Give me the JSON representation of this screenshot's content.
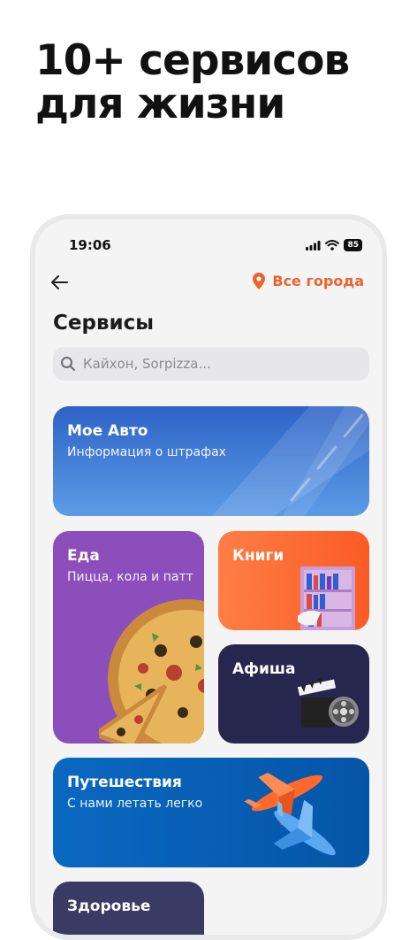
{
  "promo": {
    "line1": "10+ сервисов",
    "line2": "для жизни"
  },
  "status_bar": {
    "time": "19:06",
    "battery": "85"
  },
  "header": {
    "city": "Все города"
  },
  "page": {
    "title": "Сервисы"
  },
  "search": {
    "placeholder": "Кайхон, Sorpizza..."
  },
  "cards": {
    "auto": {
      "title": "Мое Авто",
      "subtitle": "Информация о штрафах"
    },
    "food": {
      "title": "Еда",
      "subtitle": "Пицца, кола и патт"
    },
    "books": {
      "title": "Книги"
    },
    "afisha": {
      "title": "Афиша"
    },
    "travel": {
      "title": "Путешествия",
      "subtitle": "С нами летать легко"
    },
    "health": {
      "title": "Здоровье"
    }
  },
  "icons": [
    "back-arrow-icon",
    "location-pin-icon",
    "search-icon",
    "signal-icon",
    "wifi-icon",
    "battery-icon",
    "pizza-icon",
    "bookshelf-icon",
    "clapperboard-icon",
    "airplane-icon"
  ],
  "colors": {
    "accent": "#f0622c",
    "auto": "#3f7ed8",
    "food": "#8b4ebb",
    "books": "#fb6a32",
    "afisha": "#27264e",
    "travel": "#0a63b8"
  }
}
